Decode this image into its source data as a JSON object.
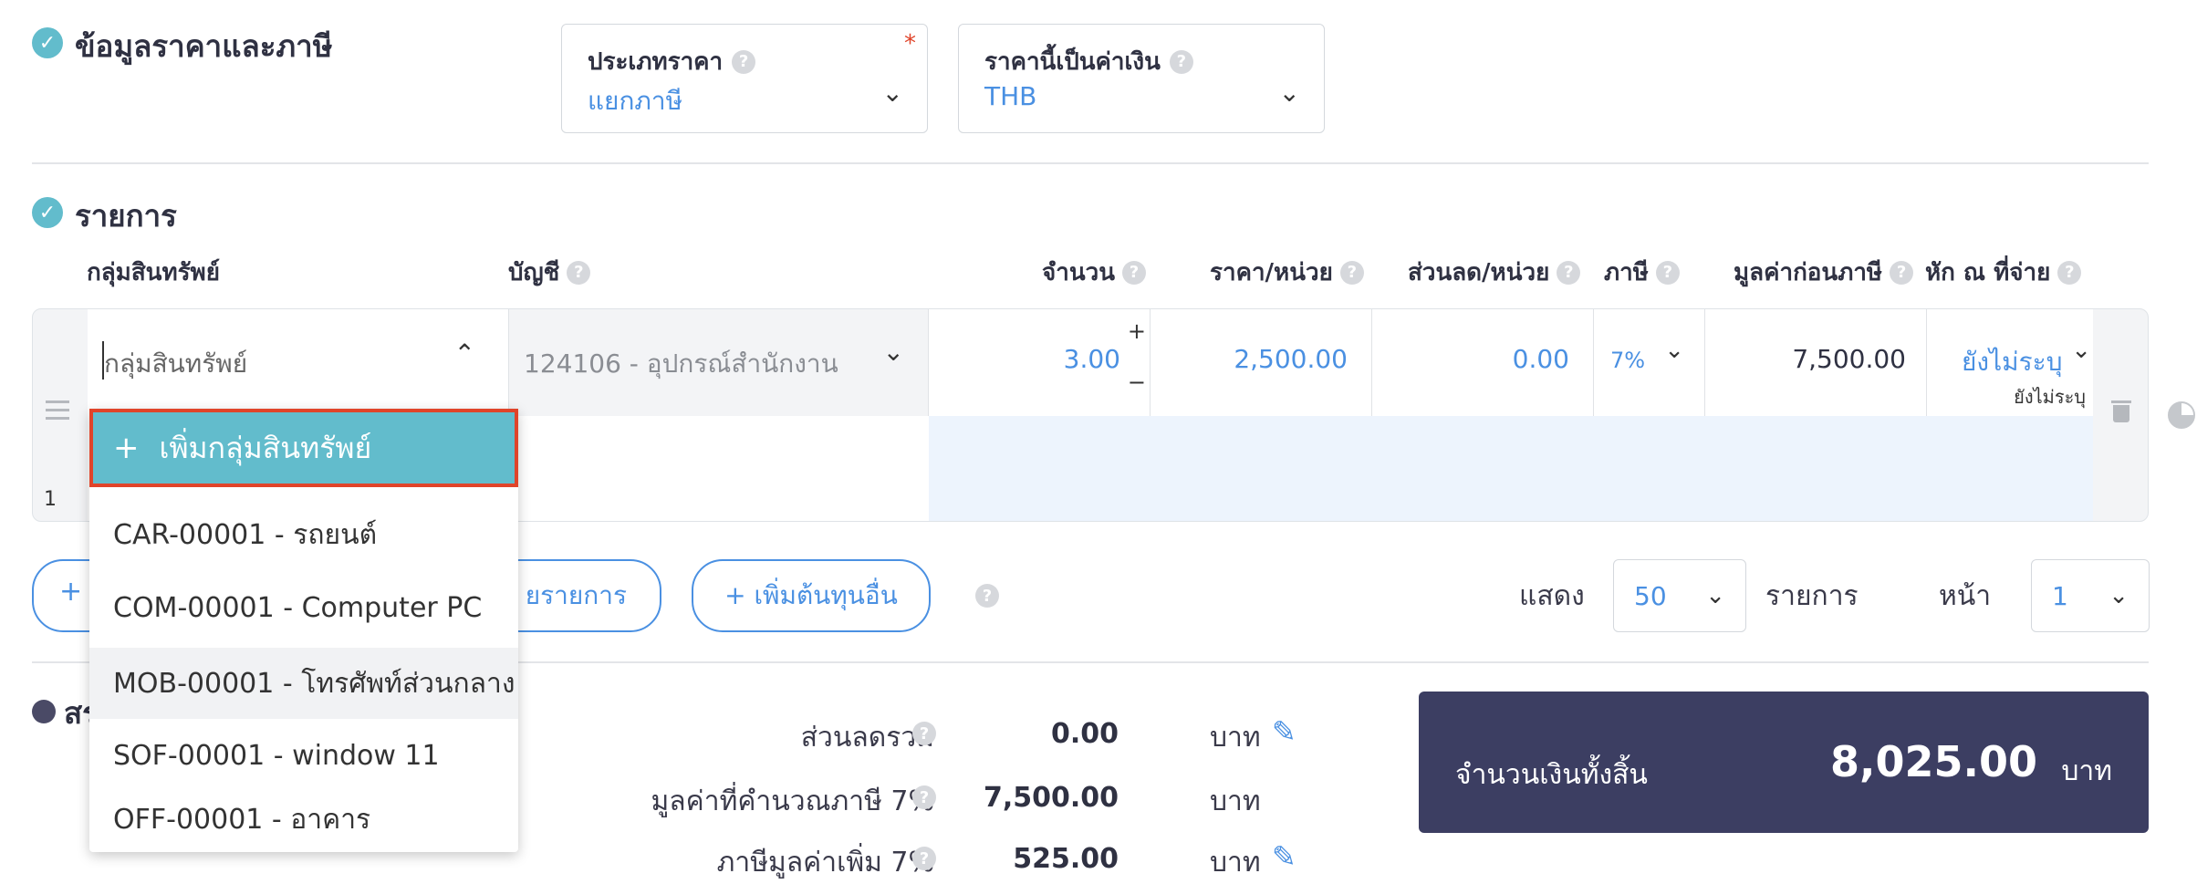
{
  "price_section": {
    "title": "ข้อมูลราคาและภาษี",
    "price_type": {
      "label": "ประเภทราคา",
      "value": "แยกภาษี",
      "required_mark": "*"
    },
    "currency": {
      "label": "ราคานี้เป็นค่าเงิน",
      "value": "THB"
    }
  },
  "items_section": {
    "title": "รายการ",
    "columns": {
      "asset_group": "กลุ่มสินทรัพย์",
      "account": "บัญชี",
      "quantity": "จำนวน",
      "unit_price": "ราคา/หน่วย",
      "discount": "ส่วนลด/หน่วย",
      "tax": "ภาษี",
      "pretax": "มูลค่าก่อนภาษี",
      "withholding": "หัก ณ ที่จ่าย"
    },
    "row": {
      "index": "1",
      "asset_group_placeholder": "กลุ่มสินทรัพย์",
      "account": "124106 - อุปกรณ์สำนักงาน",
      "quantity": "3.00",
      "unit_price": "2,500.00",
      "discount": "0.00",
      "tax": "7%",
      "pretax": "7,500.00",
      "withholding": "ยังไม่ระบุ",
      "withholding_sub": "ยังไม่ระบุ"
    },
    "dropdown": {
      "add_label": "เพิ่มกลุ่มสินทรัพย์",
      "options": [
        "CAR-00001 - รถยนต์",
        "COM-00001 - Computer PC",
        "MOB-00001 - โทรศัพท์ส่วนกลาง",
        "SOF-00001 - window 11",
        "OFF-00001 - อาคาร"
      ]
    },
    "buttons": {
      "add_item_partial": "ยรายการ",
      "add_other_cost": "+ เพิ่มต้นทุนอื่น"
    },
    "pagination": {
      "show_label": "แสดง",
      "per_page": "50",
      "items_label": "รายการ",
      "page_label": "หน้า",
      "page": "1"
    }
  },
  "summary": {
    "title_partial": "สร",
    "discount_total": {
      "label": "ส่วนลดรวม",
      "value": "0.00",
      "unit": "บาท"
    },
    "taxable": {
      "label": "มูลค่าที่คำนวณภาษี 7%",
      "value": "7,500.00",
      "unit": "บาท"
    },
    "vat": {
      "label": "ภาษีมูลค่าเพิ่ม 7%",
      "value": "525.00",
      "unit": "บาท"
    },
    "grand_total": {
      "label": "จำนวนเงินทั้งสิ้น",
      "value": "8,025.00",
      "unit": "บาท"
    }
  },
  "colors": {
    "accent": "#4a90e2",
    "teal": "#62bccc",
    "dark_panel": "#3c3e62",
    "highlight_border": "#e0442a"
  },
  "icons": [
    "check-icon",
    "help-icon",
    "chevron-down-icon",
    "chevron-up-icon",
    "drag-handle-icon",
    "trash-icon",
    "pie-chart-icon",
    "edit-pencil-icon",
    "plus-icon"
  ]
}
